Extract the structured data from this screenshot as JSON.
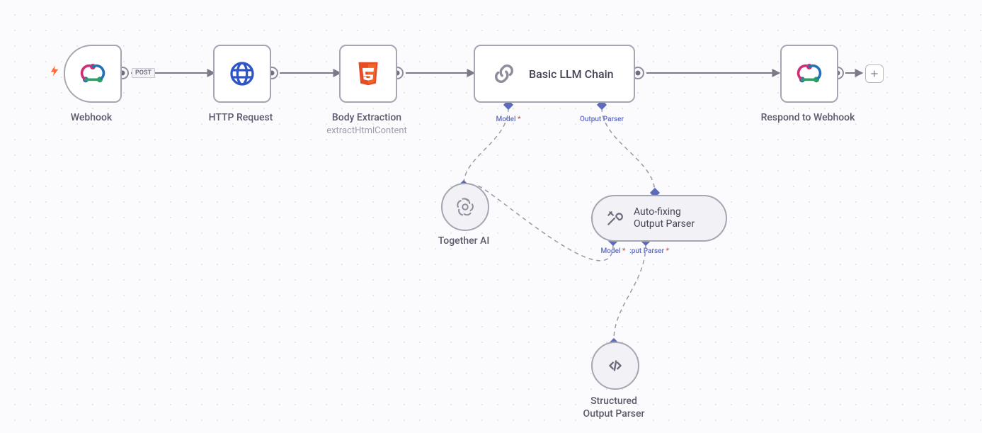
{
  "nodes": {
    "webhook": {
      "label": "Webhook",
      "badge": "POST"
    },
    "http": {
      "label": "HTTP Request"
    },
    "body": {
      "label": "Body Extraction",
      "subtitle": "extractHtmlContent"
    },
    "llm": {
      "label": "Basic LLM Chain",
      "port_model": "Model",
      "port_parser": "Output Parser"
    },
    "respond": {
      "label": "Respond to Webhook"
    },
    "together": {
      "label": "Together AI"
    },
    "autofix": {
      "line1": "Auto-fixing",
      "line2": "Output Parser",
      "port_model": "Model",
      "port_parser": ":put Parser"
    },
    "structured": {
      "line1": "Structured",
      "line2": "Output Parser"
    }
  }
}
